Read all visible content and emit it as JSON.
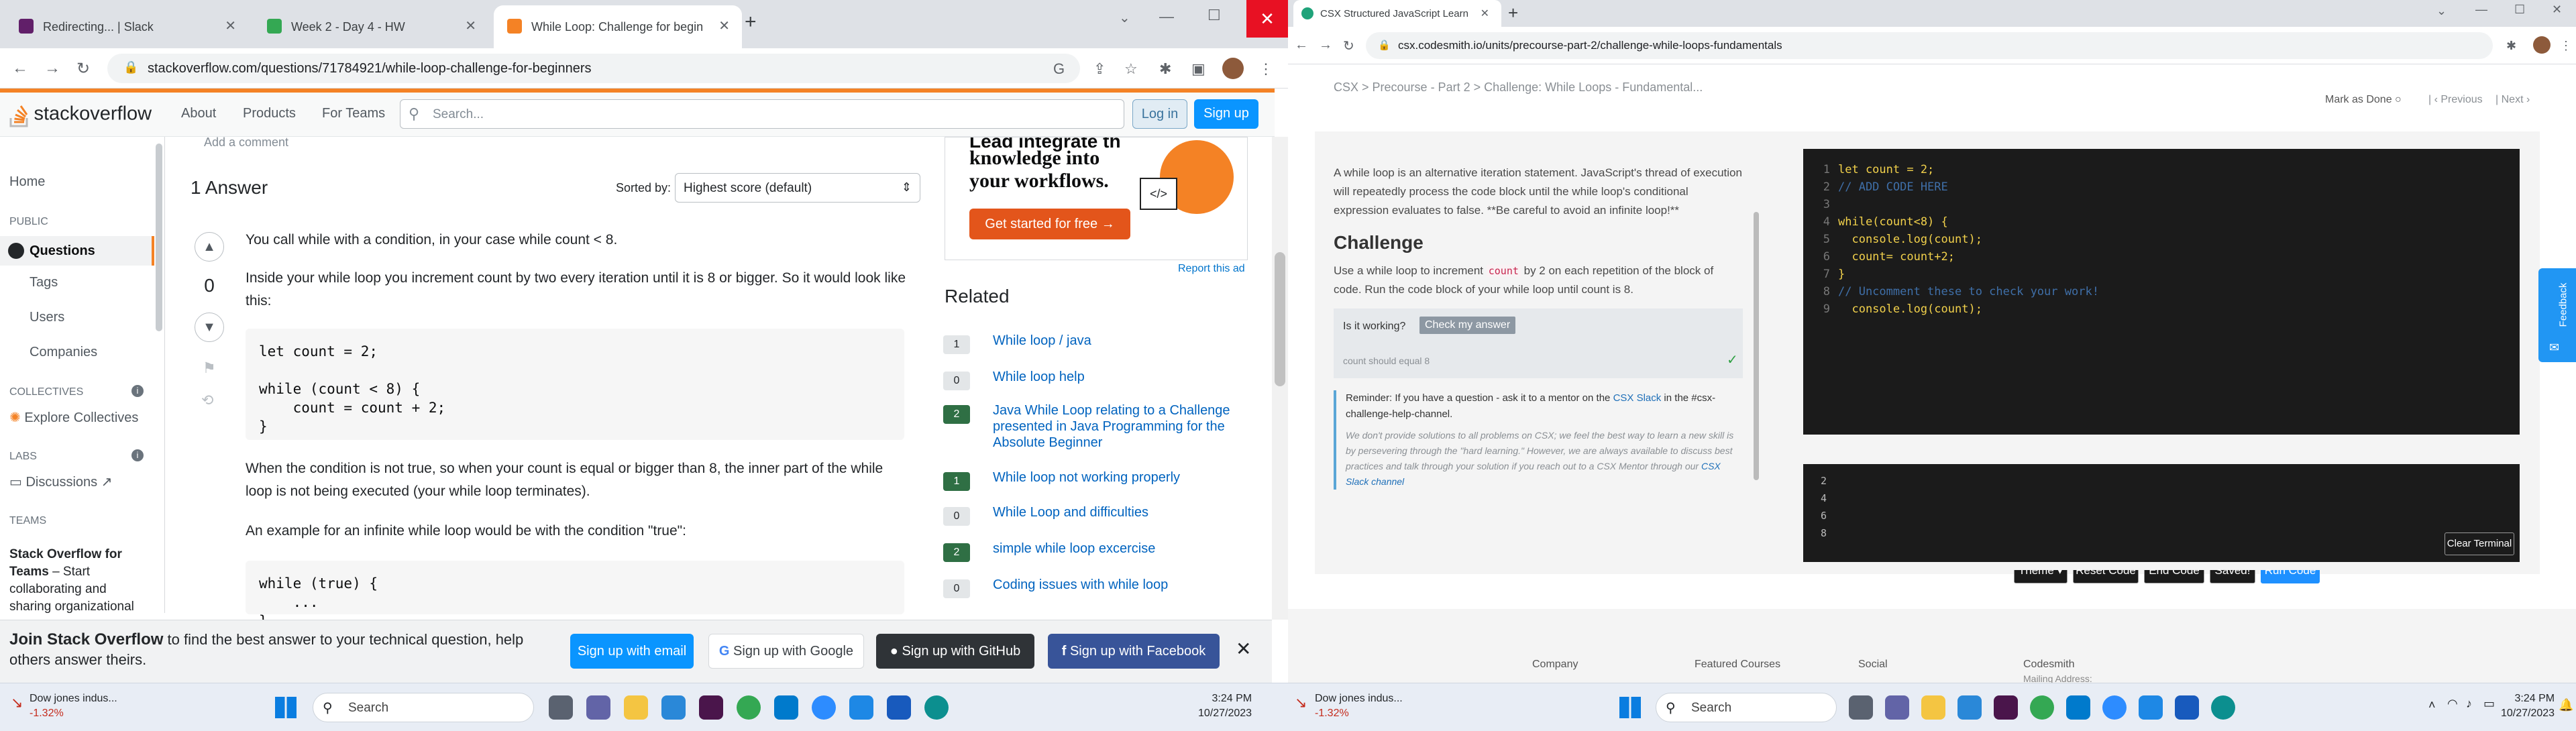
{
  "left_browser": {
    "tabs": [
      {
        "title": "Redirecting... | Slack"
      },
      {
        "title": "Week 2 - Day 4 - HW"
      },
      {
        "title": "While Loop: Challenge for begin"
      }
    ],
    "url": "stackoverflow.com/questions/71784921/while-loop-challenge-for-beginners"
  },
  "so": {
    "logo_text": "stackoverflow",
    "nav": [
      "About",
      "Products",
      "For Teams"
    ],
    "search_placeholder": "Search...",
    "login": "Log in",
    "signup": "Sign up",
    "sidebar": {
      "home": "Home",
      "public": "PUBLIC",
      "questions": "Questions",
      "tags": "Tags",
      "users": "Users",
      "companies": "Companies",
      "collectives": "COLLECTIVES",
      "explore": "Explore Collectives",
      "labs": "LABS",
      "discussions": "Discussions",
      "teams": "TEAMS",
      "teams_title": "Stack Overflow for Teams",
      "teams_desc": "– Start collaborating and sharing organizational"
    },
    "add_comment": "Add a comment",
    "answers_count": "1 Answer",
    "sorted_by": "Sorted by:",
    "sort_value": "Highest score (default)",
    "vote_count": "0",
    "answer_p1": "You call while with a condition, in your case while count < 8.",
    "answer_p2": "Inside your while loop you increment count by two every iteration until it is 8 or bigger. So it would look like this:",
    "code1": "let count = 2;\n\nwhile (count < 8) {\n    count = count + 2;\n}",
    "answer_p3": "When the condition is not true, so when your count is equal or bigger than 8, the inner part of the while loop is not being executed (your while loop terminates).",
    "answer_p4": "An example for an infinite while loop would be with the condition \"true\":",
    "code2": "while (true) {\n    ...\n}",
    "ad": {
      "headline": "knowledge into your workflows.",
      "headline_top": "Lead integrate th",
      "button": "Get started for free",
      "report": "Report this ad"
    },
    "related_title": "Related",
    "related": [
      {
        "score": "1",
        "title": "While loop / java",
        "accepted": false
      },
      {
        "score": "0",
        "title": "While loop help",
        "accepted": false
      },
      {
        "score": "2",
        "title": "Java While Loop relating to a Challenge presented in Java Programming for the Absolute Beginner",
        "accepted": true
      },
      {
        "score": "1",
        "title": "While loop not working properly",
        "accepted": true
      },
      {
        "score": "0",
        "title": "While Loop and difficulties",
        "accepted": false
      },
      {
        "score": "2",
        "title": "simple while loop excercise",
        "accepted": true
      },
      {
        "score": "0",
        "title": "Coding issues with while loop",
        "accepted": false
      }
    ],
    "banner": {
      "bold": "Join Stack Overflow",
      "text": " to find the best answer to your technical question, help others answer theirs.",
      "email": "Sign up with email",
      "google": "Sign up with Google",
      "github": "Sign up with GitHub",
      "facebook": "Sign up with Facebook"
    }
  },
  "right_browser": {
    "tabs": [
      {
        "title": "CSX Structured JavaScript Learn"
      }
    ],
    "url": "csx.codesmith.io/units/precourse-part-2/challenge-while-loops-fundamentals"
  },
  "csx": {
    "breadcrumb": "CSX > Precourse - Part 2 > Challenge: While Loops - Fundamental...",
    "mark_done": "Mark as Done",
    "previous": "Previous",
    "next": "Next",
    "intro": "A while loop is an alternative iteration statement. JavaScript's thread of execution will repeatedly process the code block until the while loop's conditional expression evaluates to false. **Be careful to avoid an infinite loop!**",
    "challenge_title": "Challenge",
    "challenge_pre": "Use a while loop to increment ",
    "challenge_code": "count",
    "challenge_post": " by 2 on each repetition of the block of code. Run the code block of your while loop until count is 8.",
    "is_working": "Is it working?",
    "check": "Check my answer",
    "test_result": "count should equal 8",
    "reminder_pre": "Reminder: If you have a question - ask it to a mentor on the ",
    "reminder_link": "CSX Slack",
    "reminder_post": " in the #csx-challenge-help-channel.",
    "disclaimer": "We don't provide solutions to all problems on CSX; we feel the best way to learn a new skill is by persevering through the \"hard learning.\" However, we are always available to discuss best practices and talk through your solution if you reach out to a CSX Mentor through our ",
    "disclaimer_link": "CSX Slack channel",
    "editor_lines": [
      "let count = 2;",
      "// ADD CODE HERE",
      "",
      "while(count<8) {",
      "  console.log(count);",
      "  count= count+2;",
      "}",
      "// Uncomment these to check your work!",
      "  console.log(count);"
    ],
    "buttons": {
      "theme": "Theme",
      "reset": "Reset Code",
      "end": "End Code",
      "saved": "Saved!",
      "run": "Run Code"
    },
    "terminal": [
      "2",
      "4",
      "6",
      "8"
    ],
    "clear_terminal": "Clear Terminal",
    "feedback": "Feedback",
    "footer": [
      "Company",
      "Featured Courses",
      "Social",
      "Codesmith"
    ],
    "footer_sub": "Mailing Address:"
  },
  "taskbar_left": {
    "stock_name": "Dow jones indus...",
    "stock_change": "-1.32%",
    "search": "Search",
    "time": "3:24 PM",
    "date": "10/27/2023"
  },
  "taskbar_right": {
    "stock_name": "Dow jones indus...",
    "stock_change": "-1.32%",
    "search": "Search",
    "time": "3:24 PM",
    "date": "10/27/2023"
  },
  "colors": {
    "so_orange": "#f48225",
    "so_blue": "#0a95ff",
    "csx_editor": "#1b1b1b",
    "csx_run": "#1e90ff"
  }
}
